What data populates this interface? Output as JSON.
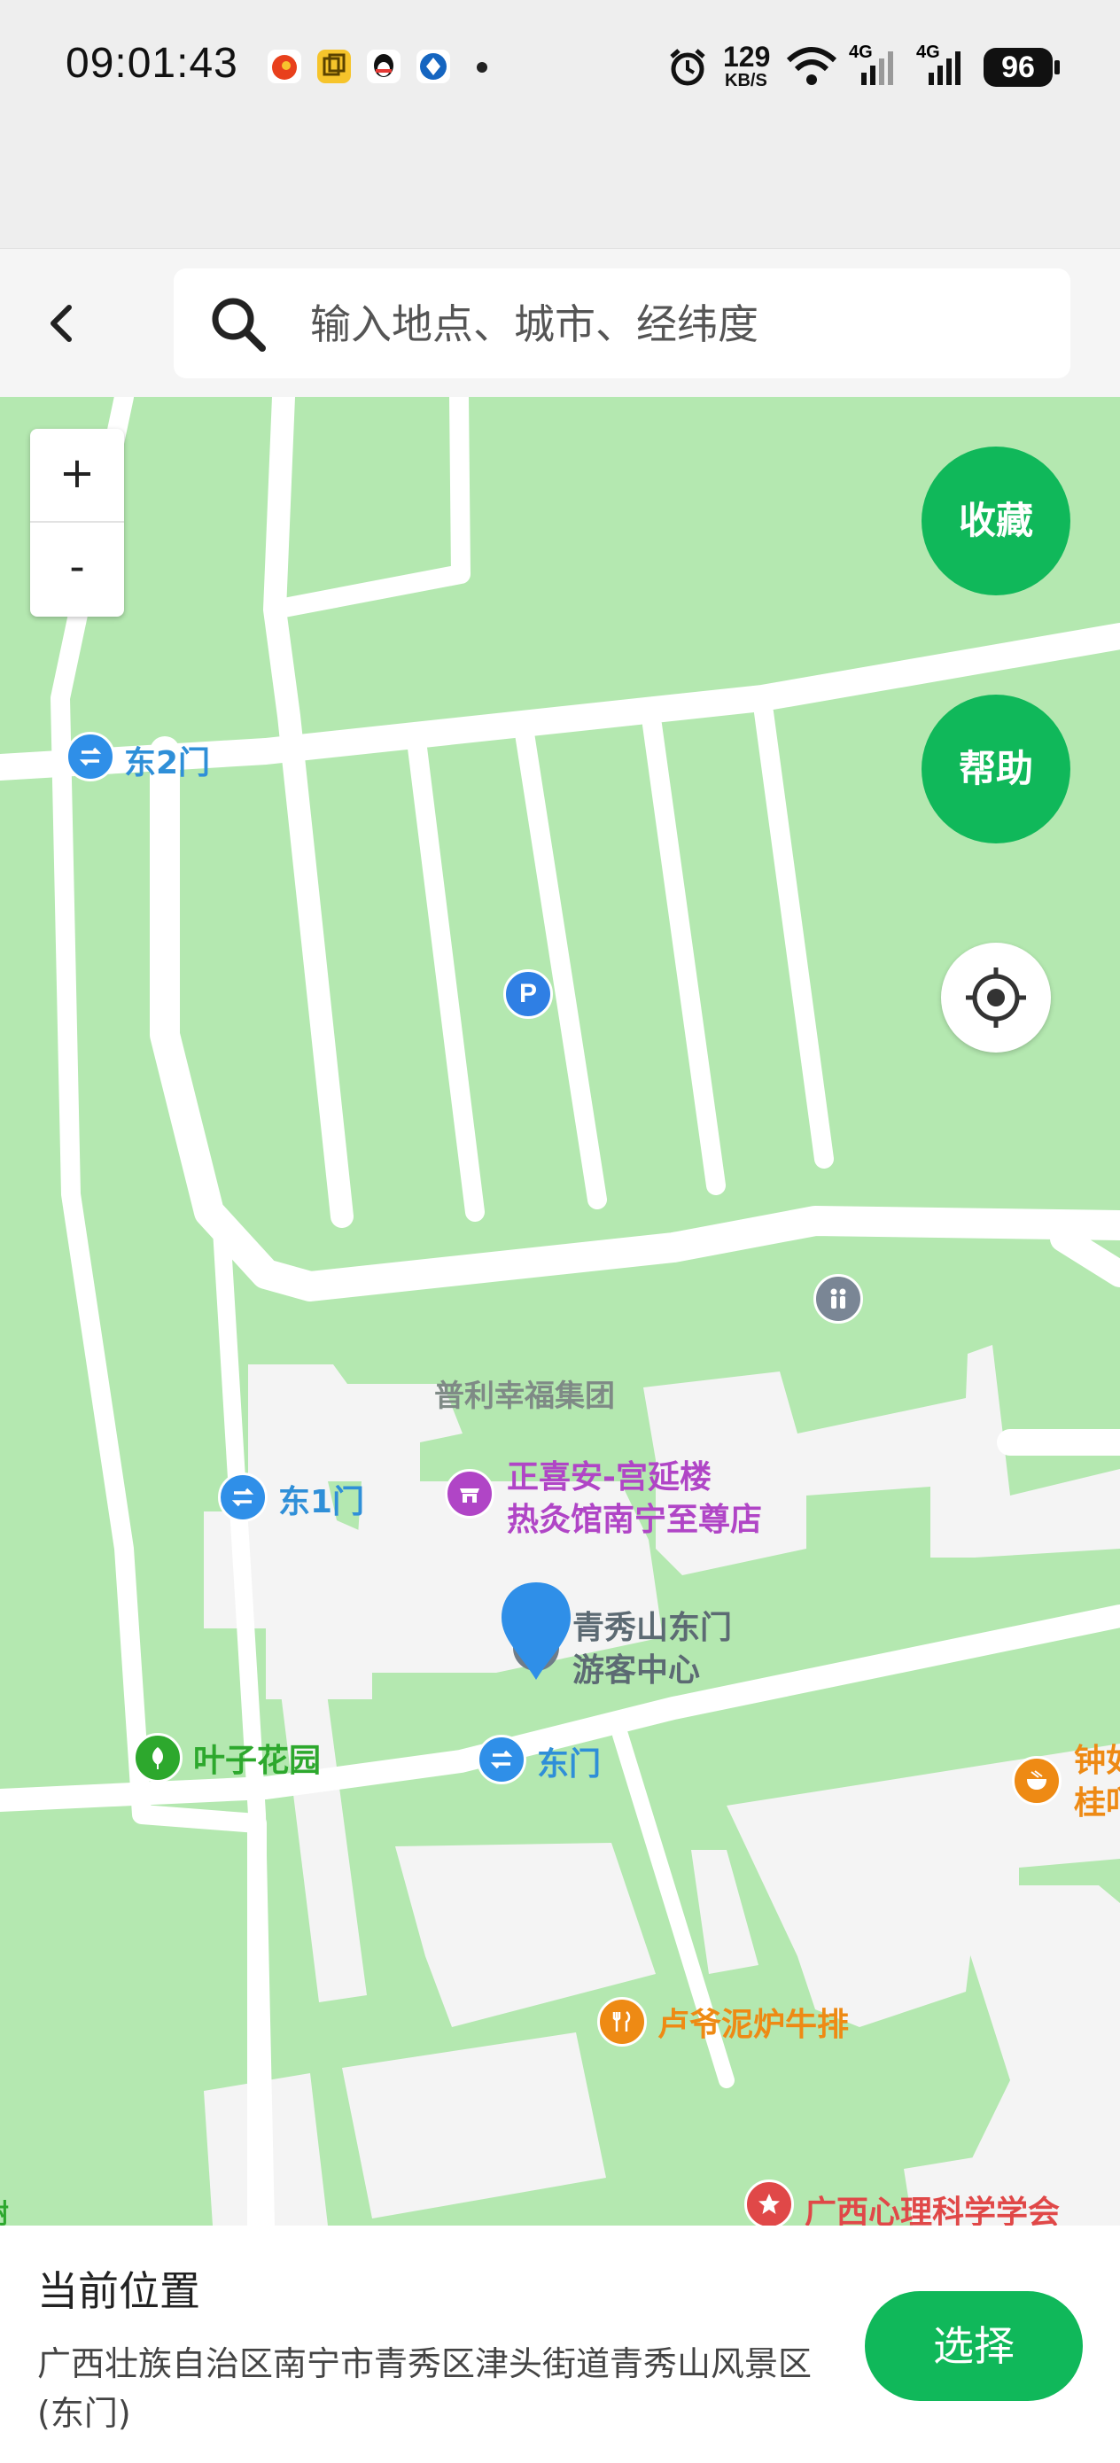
{
  "status_bar": {
    "time": "09:01:43",
    "net_speed_value": "129",
    "net_speed_unit": "KB/S",
    "sim1_label": "4G",
    "sim2_label": "4G",
    "battery": "96"
  },
  "header": {
    "search_placeholder": "输入地点、城市、经纬度"
  },
  "map": {
    "zoom_in_label": "+",
    "zoom_out_label": "-",
    "favorite_label": "收藏",
    "help_label": "帮助",
    "labels": {
      "east_gate_2": "东2门",
      "east_gate_1": "东1门",
      "east_gate": "东门",
      "puli_group": "普利幸福集团",
      "zhengxian_line1": "正喜安-宫延楼",
      "zhengxian_line2": "热灸馆南宁至尊店",
      "visitor_center_line1": "青秀山东门",
      "visitor_center_line2": "游客中心",
      "yezi_garden": "叶子花园",
      "luye_steak": "卢爷泥炉牛排",
      "zhong_partial_1": "钟如",
      "zhong_partial_2": "桂吖",
      "psych_society": "广西心理科学学会",
      "left_edge_partial": "树"
    },
    "colors": {
      "land": "#b4e8b0",
      "road": "#ffffff",
      "block": "#f4f4f4",
      "accent_green": "#10b85a",
      "marker_blue": "#2f8fe8"
    }
  },
  "bottom_panel": {
    "title": "当前位置",
    "address": "广西壮族自治区南宁市青秀区津头街道青秀山风景区(东门)",
    "select_label": "选择"
  }
}
